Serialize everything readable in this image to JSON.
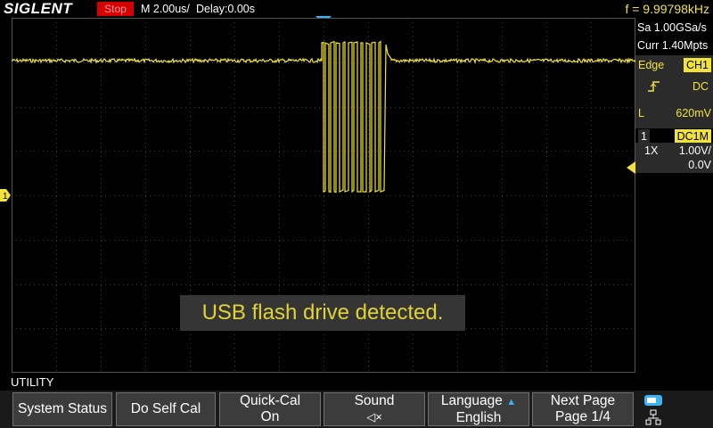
{
  "header": {
    "brand": "SIGLENT",
    "run_state": "Stop",
    "timebase": "M 2.00us/",
    "delay": "Delay:0.00s",
    "frequency": "f = 9.99798kHz"
  },
  "acquisition": {
    "sample_rate": "Sa 1.00GSa/s",
    "memory_depth": "Curr 1.40Mpts"
  },
  "trigger": {
    "type": "Edge",
    "source": "CH1",
    "slope_icon": "rising-edge-icon",
    "coupling": "DC",
    "level_label": "L",
    "level": "620mV"
  },
  "channel": {
    "number": "1",
    "coupling_impedance": "DC1M",
    "probe": "1X",
    "scale": "1.00V/",
    "offset": "0.0V",
    "ground_marker": "1"
  },
  "notice": "USB flash drive detected.",
  "menu": {
    "title": "UTILITY",
    "buttons": [
      {
        "line1": "System Status",
        "line2": ""
      },
      {
        "line1": "Do Self Cal",
        "line2": ""
      },
      {
        "line1": "Quick-Cal",
        "line2": "On"
      },
      {
        "line1": "Sound",
        "line2": "◁×"
      },
      {
        "line1": "Language",
        "line2": "English"
      },
      {
        "line1": "Next Page",
        "line2": "Page 1/4"
      }
    ]
  },
  "colors": {
    "trace": "#f2e33b",
    "stop": "#d40000",
    "trigger_marker": "#3ab4f2"
  }
}
